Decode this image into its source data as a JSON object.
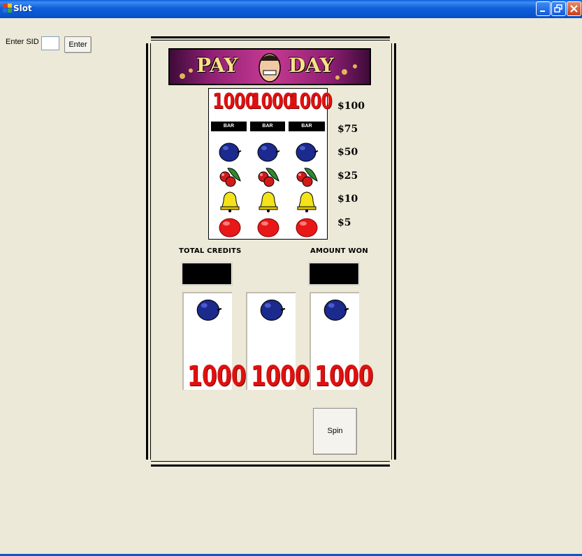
{
  "window": {
    "title": "Slot",
    "accent": "#0a5ed8"
  },
  "sid": {
    "label": "Enter SID",
    "value": "",
    "button_label": "Enter"
  },
  "banner": {
    "left_text": "PAY",
    "right_text": "DAY"
  },
  "paytable": {
    "rows": [
      {
        "symbol": "1000",
        "payout": "$100"
      },
      {
        "symbol": "BAR",
        "payout": "$75"
      },
      {
        "symbol": "plum",
        "payout": "$50"
      },
      {
        "symbol": "cherry",
        "payout": "$25"
      },
      {
        "symbol": "bell",
        "payout": "$10"
      },
      {
        "symbol": "orange",
        "payout": "$5"
      }
    ]
  },
  "credits": {
    "label": "TOTAL CREDITS",
    "value": ""
  },
  "won": {
    "label": "AMOUNT WON",
    "value": ""
  },
  "reels": [
    {
      "top_symbol": "plum",
      "bottom_text": "1000"
    },
    {
      "top_symbol": "plum",
      "bottom_text": "1000"
    },
    {
      "top_symbol": "plum",
      "bottom_text": "1000"
    }
  ],
  "spin": {
    "label": "Spin"
  }
}
